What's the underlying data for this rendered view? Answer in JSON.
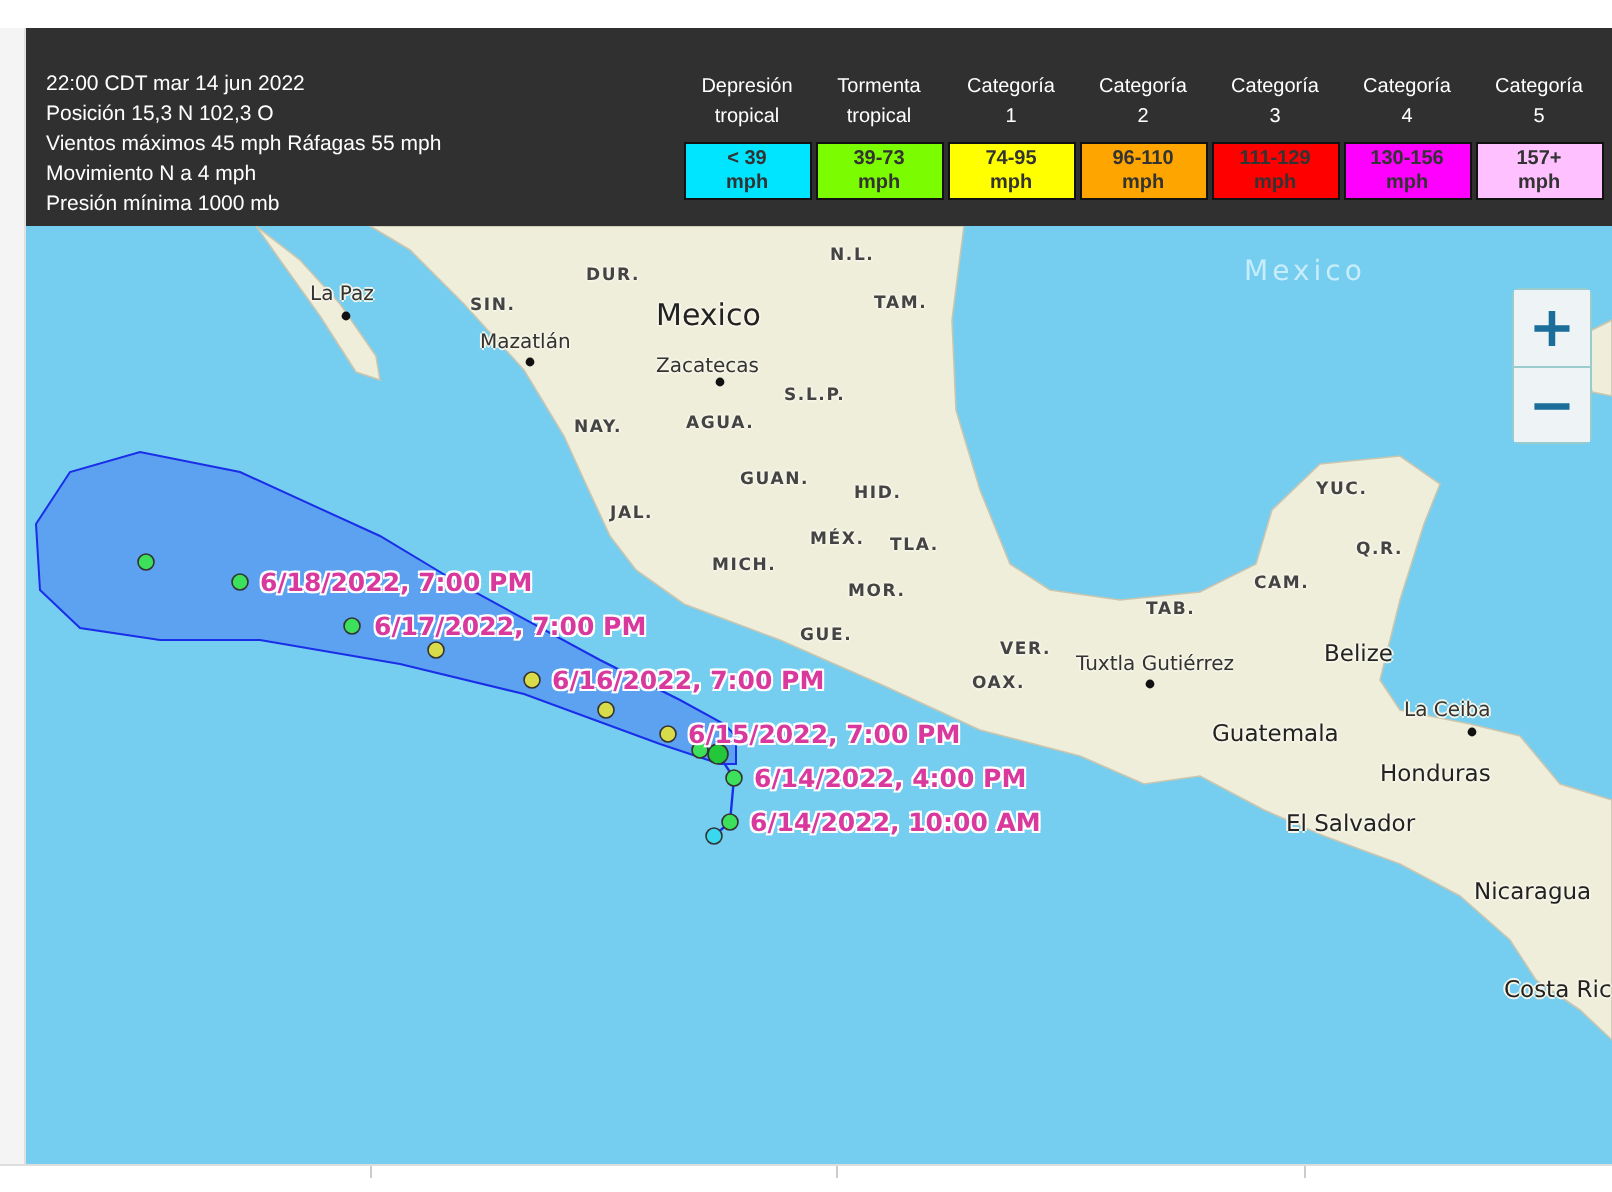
{
  "storm_info": {
    "lines": [
      "22:00 CDT mar 14 jun 2022",
      "Posición 15,3 N 102,3 O",
      "Vientos máximos 45 mph Ráfagas 55 mph",
      "Movimiento N a 4 mph",
      "Presión mínima 1000 mb"
    ]
  },
  "legend": [
    {
      "name": [
        "Depresión",
        "tropical"
      ],
      "range": [
        "< 39",
        "mph"
      ],
      "color": "#00e5ff"
    },
    {
      "name": [
        "Tormenta",
        "tropical"
      ],
      "range": [
        "39-73",
        "mph"
      ],
      "color": "#7cfc00"
    },
    {
      "name": [
        "Categoría",
        "1"
      ],
      "range": [
        "74-95",
        "mph"
      ],
      "color": "#ffff00"
    },
    {
      "name": [
        "Categoría",
        "2"
      ],
      "range": [
        "96-110",
        "mph"
      ],
      "color": "#ffa500"
    },
    {
      "name": [
        "Categoría",
        "3"
      ],
      "range": [
        "111-129",
        "mph"
      ],
      "color": "#ff0000"
    },
    {
      "name": [
        "Categoría",
        "4"
      ],
      "range": [
        "130-156",
        "mph"
      ],
      "color": "#ff00ff"
    },
    {
      "name": [
        "Categoría",
        "5"
      ],
      "range": [
        "157+",
        "mph"
      ],
      "color": "#ffc0ff"
    }
  ],
  "map": {
    "places": [
      {
        "name": "La Paz",
        "kind": "city"
      },
      {
        "name": "SIN.",
        "kind": "state"
      },
      {
        "name": "DUR.",
        "kind": "state"
      },
      {
        "name": "Mexico",
        "kind": "country"
      },
      {
        "name": "N.L.",
        "kind": "state"
      },
      {
        "name": "TAM.",
        "kind": "state"
      },
      {
        "name": "Mazatlán",
        "kind": "city"
      },
      {
        "name": "Zacatecas",
        "kind": "city"
      },
      {
        "name": "S.L.P.",
        "kind": "state"
      },
      {
        "name": "NAY.",
        "kind": "state"
      },
      {
        "name": "AGUA.",
        "kind": "state"
      },
      {
        "name": "GUAN.",
        "kind": "state"
      },
      {
        "name": "HID.",
        "kind": "state"
      },
      {
        "name": "JAL.",
        "kind": "state"
      },
      {
        "name": "MÉX.",
        "kind": "state"
      },
      {
        "name": "TLA.",
        "kind": "state"
      },
      {
        "name": "MICH.",
        "kind": "state"
      },
      {
        "name": "MOR.",
        "kind": "state"
      },
      {
        "name": "GUE.",
        "kind": "state"
      },
      {
        "name": "VER.",
        "kind": "state"
      },
      {
        "name": "OAX.",
        "kind": "state"
      },
      {
        "name": "TAB.",
        "kind": "state"
      },
      {
        "name": "CAM.",
        "kind": "state"
      },
      {
        "name": "YUC.",
        "kind": "state"
      },
      {
        "name": "Q.R.",
        "kind": "state"
      },
      {
        "name": "Tuxtla Gutiérrez",
        "kind": "city"
      },
      {
        "name": "Belize",
        "kind": "country"
      },
      {
        "name": "Guatemala",
        "kind": "country"
      },
      {
        "name": "La Ceiba",
        "kind": "city"
      },
      {
        "name": "Honduras",
        "kind": "country"
      },
      {
        "name": "El Salvador",
        "kind": "country"
      },
      {
        "name": "Nicaragua",
        "kind": "country"
      },
      {
        "name": "Costa Ric",
        "kind": "country"
      },
      {
        "name": "Mexico",
        "kind": "sea"
      }
    ],
    "track_points": [
      {
        "color": "#3ce05a"
      },
      {
        "color": "#3ce05a"
      },
      {
        "color": "#3ce05a"
      },
      {
        "color": "#d8dc4a"
      },
      {
        "color": "#d8dc4a"
      },
      {
        "color": "#d8dc4a"
      },
      {
        "color": "#d8dc4a"
      },
      {
        "color": "#3ce05a"
      },
      {
        "color": "#22c83a"
      },
      {
        "color": "#3ce05a"
      },
      {
        "color": "#3ce05a"
      },
      {
        "color": "#3ad8ee"
      }
    ],
    "track_labels": [
      "6/18/2022, 7:00 PM",
      "6/17/2022, 7:00 PM",
      "6/16/2022, 7:00 PM",
      "6/15/2022, 7:00 PM",
      "6/14/2022, 4:00 PM",
      "6/14/2022, 10:00 AM"
    ],
    "zoom_buttons": [
      "+",
      "−"
    ]
  }
}
